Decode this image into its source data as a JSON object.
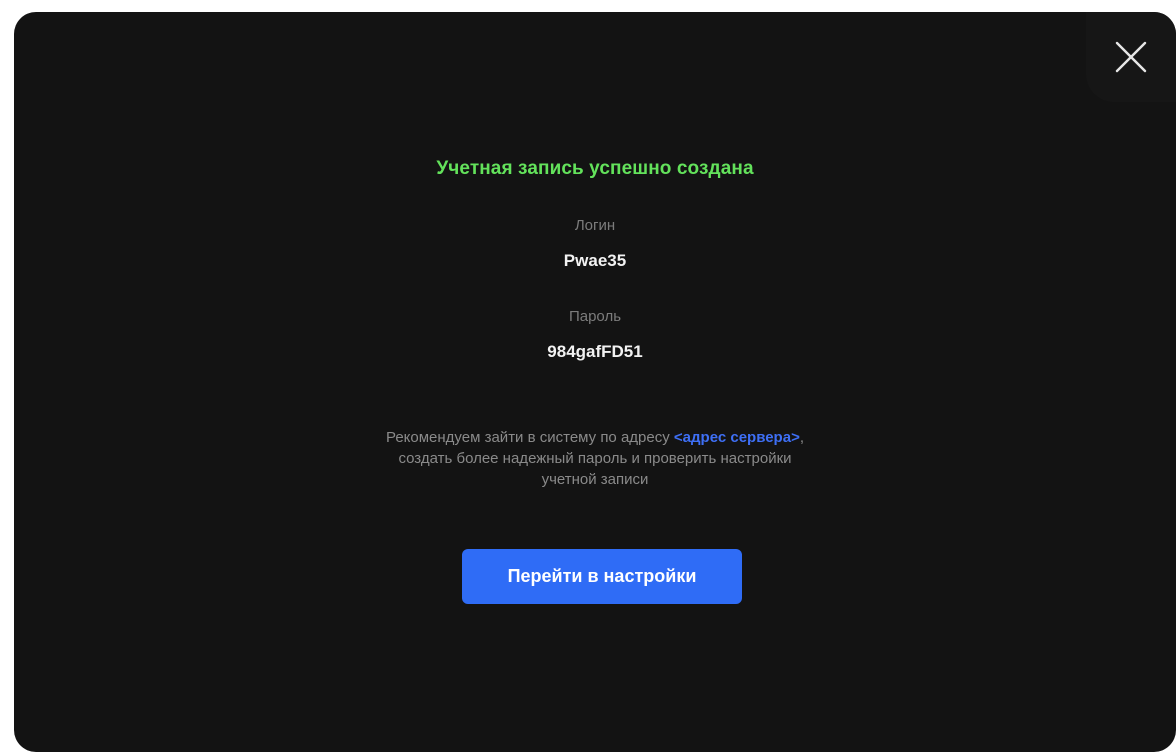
{
  "dialog": {
    "title": "Учетная запись успешно создана",
    "login": {
      "label": "Логин",
      "value": "Pwae35"
    },
    "password": {
      "label": "Пароль",
      "value": "984gafFD51"
    },
    "recommendation": {
      "line1_prefix": "Рекомендуем зайти в систему по адресу ",
      "server_link": "<адрес сервера>",
      "line1_suffix": ",",
      "line2": "создать более надежный пароль и проверить настройки",
      "line3": "учетной записи"
    },
    "primary_button": "Перейти в настройки",
    "close_icon": "close-icon"
  },
  "colors": {
    "background": "#131313",
    "title_green": "#63e25b",
    "label_gray": "#7c7c7c",
    "value_white": "#f2f2f2",
    "link_blue": "#3e6ff5",
    "button_blue": "#2f6cf6"
  }
}
